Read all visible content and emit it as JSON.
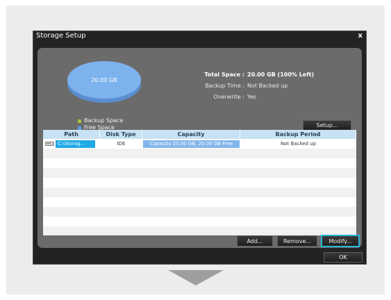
{
  "dialog": {
    "title": "Storage Setup",
    "close_label": "x",
    "ok_label": "OK"
  },
  "pie": {
    "label": "20.00 GB",
    "free_color": "#7eb2ee",
    "backup_color": "#9bbd3a"
  },
  "legend": [
    {
      "label": "Backup Space",
      "color": "#a8c23a"
    },
    {
      "label": "Free Space",
      "color": "#5f9fe8"
    }
  ],
  "info": {
    "total_space_label": "Total Space :",
    "total_space_value": "20.00 GB (100% Left)",
    "backup_time_label": "Backup Time :",
    "backup_time_value": "Not Backed up",
    "overwrite_label": "Overwrite :",
    "overwrite_value": "Yes"
  },
  "setup_label": "Setup...",
  "table": {
    "headers": [
      "Path",
      "Disk Type",
      "Capacity",
      "Backup Period"
    ],
    "row": {
      "path": "C:\\Storag...",
      "disk_type": "IDE",
      "capacity": "Capacity 20.00 GB, 20.00 GB Free",
      "backup_period": "Not Backed up"
    }
  },
  "buttons": {
    "add": "Add...",
    "remove": "Remove...",
    "modify": "Modify..."
  }
}
